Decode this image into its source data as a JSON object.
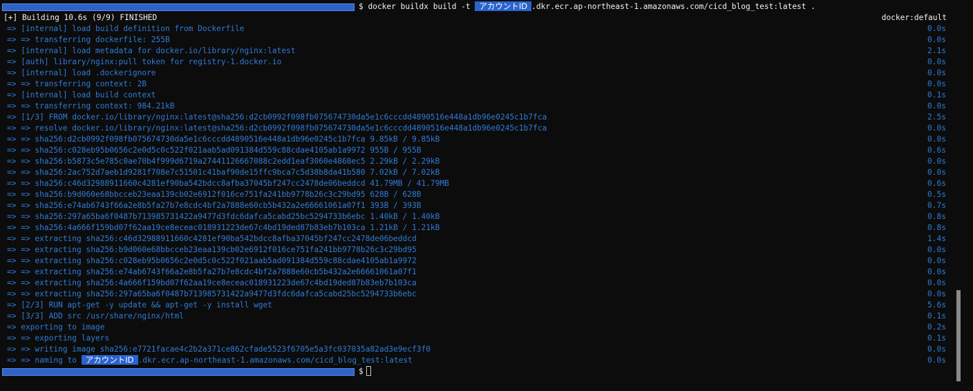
{
  "command": {
    "prefix": "$ docker buildx build -t ",
    "redacted_label": "アカウントID",
    "suffix": ".dkr.ecr.ap-northeast-1.amazonaws.com/cicd_blog_test:latest ."
  },
  "header": {
    "status": "[+] Building 10.6s (9/9) FINISHED",
    "context": "docker:default"
  },
  "steps": [
    {
      "text": "=> [internal] load build definition from Dockerfile",
      "time": "0.0s"
    },
    {
      "text": "=> => transferring dockerfile: 255B",
      "time": "0.0s"
    },
    {
      "text": "=> [internal] load metadata for docker.io/library/nginx:latest",
      "time": "2.1s"
    },
    {
      "text": "=> [auth] library/nginx:pull token for registry-1.docker.io",
      "time": "0.0s"
    },
    {
      "text": "=> [internal] load .dockerignore",
      "time": "0.0s"
    },
    {
      "text": "=> => transferring context: 2B",
      "time": "0.0s"
    },
    {
      "text": "=> [internal] load build context",
      "time": "0.1s"
    },
    {
      "text": "=> => transferring context: 984.21kB",
      "time": "0.0s"
    },
    {
      "text": "=> [1/3] FROM docker.io/library/nginx:latest@sha256:d2cb0992f098fb075674730da5e1c6cccdd4890516e448a1db96e0245c1b7fca",
      "time": "2.5s"
    },
    {
      "text": "=> => resolve docker.io/library/nginx:latest@sha256:d2cb0992f098fb075674730da5e1c6cccdd4890516e448a1db96e0245c1b7fca",
      "time": "0.0s"
    },
    {
      "text": "=> => sha256:d2cb0992f098fb075674730da5e1c6cccdd4890516e448a1db96e0245c1b7fca 9.85kB / 9.85kB",
      "time": "0.0s"
    },
    {
      "text": "=> => sha256:c028eb95b0656c2e0d5c0c522f021aab5ad091384d559c88cdae4105ab1a9972 955B / 955B",
      "time": "0.6s"
    },
    {
      "text": "=> => sha256:b5873c5e785c0ae70b4f999d6719a27441126667088c2edd1eaf3060e4868ec5 2.29kB / 2.29kB",
      "time": "0.0s"
    },
    {
      "text": "=> => sha256:2ac752d7aeb1d9281f708e7c51501c41baf90de15ffc9bca7c5d38b8da41b580 7.02kB / 7.02kB",
      "time": "0.0s"
    },
    {
      "text": "=> => sha256:c46d32988911660c4281ef90ba542bdcc8afba37045bf247cc2478de06beddcd 41.79MB / 41.79MB",
      "time": "0.6s"
    },
    {
      "text": "=> => sha256:b9d060e68bbcceb23eaa139cb02e6912f016ce751fa241bb9778b26c3c29bd95 628B / 628B",
      "time": "0.5s"
    },
    {
      "text": "=> => sha256:e74ab6743f66a2e8b5fa27b7e8cdc4bf2a7888e60cb5b432a2e66661061a07f1 393B / 393B",
      "time": "0.7s"
    },
    {
      "text": "=> => sha256:297a65ba6f0487b713985731422a9477d3fdc6dafca5cabd25bc5294733b6ebc 1.40kB / 1.40kB",
      "time": "0.8s"
    },
    {
      "text": "=> => sha256:4a666f159bd07f62aa19ce8eceac018931223de67c4bd19ded87b83eb7b103ca 1.21kB / 1.21kB",
      "time": "0.8s"
    },
    {
      "text": "=> => extracting sha256:c46d32988911660c4281ef90ba542bdcc8afba37045bf247cc2478de06beddcd",
      "time": "1.4s"
    },
    {
      "text": "=> => extracting sha256:b9d060e68bbcceb23eaa139cb02e6912f016ce751fa241bb9778b26c3c29bd95",
      "time": "0.0s"
    },
    {
      "text": "=> => extracting sha256:c028eb95b0656c2e0d5c0c522f021aab5ad091384d559c88cdae4105ab1a9972",
      "time": "0.0s"
    },
    {
      "text": "=> => extracting sha256:e74ab6743f66a2e8b5fa27b7e8cdc4bf2a7888e60cb5b432a2e66661061a07f1",
      "time": "0.0s"
    },
    {
      "text": "=> => extracting sha256:4a666f159bd07f62aa19ce8eceac018931223de67c4bd19ded87b83eb7b103ca",
      "time": "0.0s"
    },
    {
      "text": "=> => extracting sha256:297a65ba6f0487b713985731422a9477d3fdc6dafca5cabd25bc5294733b6ebc",
      "time": "0.0s"
    },
    {
      "text": "=> [2/3] RUN apt-get -y update && apt-get -y install wget",
      "time": "5.6s"
    },
    {
      "text": "=> [3/3] ADD src /usr/share/nginx/html",
      "time": "0.1s"
    },
    {
      "text": "=> exporting to image",
      "time": "0.2s"
    },
    {
      "text": "=> => exporting layers",
      "time": "0.1s"
    },
    {
      "text": "=> => writing image sha256:e7721facae4c2b2a371ce862cfade5523f6705e5a3fc037035a82ad3e9ecf3f0",
      "time": "0.0s"
    }
  ],
  "naming_step": {
    "prefix": "=> => naming to ",
    "redacted_label": "アカウントID",
    "suffix": ".dkr.ecr.ap-northeast-1.amazonaws.com/cicd_blog_test:latest",
    "time": "0.0s"
  },
  "prompt": {
    "symbol": "$"
  }
}
